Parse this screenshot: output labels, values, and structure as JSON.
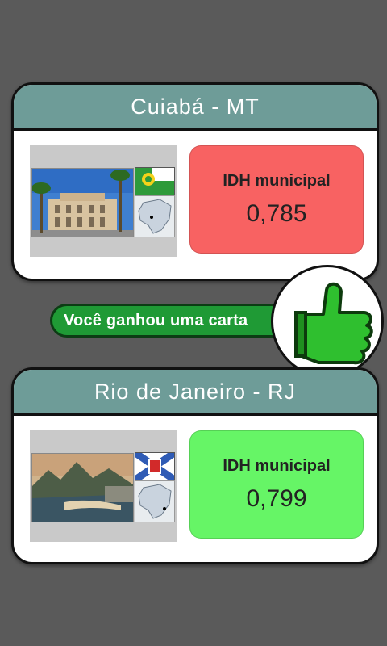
{
  "cards": [
    {
      "title": "Cuiabá - MT",
      "stat_label": "IDH municipal",
      "stat_value": "0,785",
      "status": "lose",
      "status_color": "#f86262"
    },
    {
      "title": "Rio de Janeiro - RJ",
      "stat_label": "IDH municipal",
      "stat_value": "0,799",
      "status": "win",
      "status_color": "#66f566"
    }
  ],
  "banner": {
    "text": "Você ganhou uma carta",
    "icon": "thumbs-up-icon",
    "color": "#1f9a35"
  },
  "colors": {
    "background": "#5a5a5a",
    "header": "#6e9c98"
  }
}
